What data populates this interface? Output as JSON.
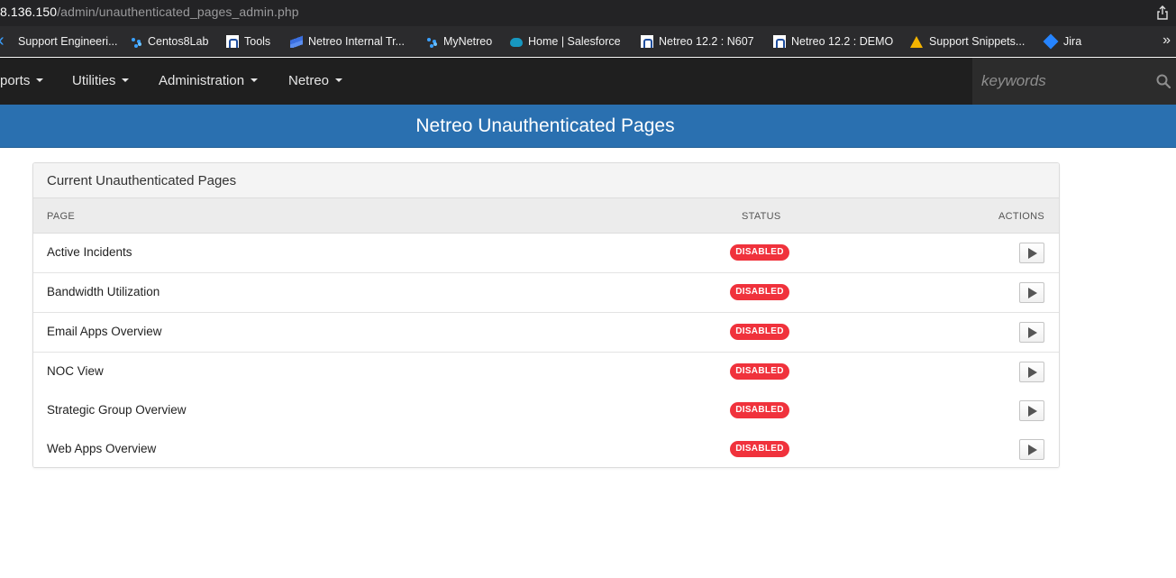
{
  "browser": {
    "url_host": "8.136.150",
    "url_path": "/admin/unauthenticated_pages_admin.php",
    "bookmarks": [
      {
        "label": "Support Engineeri...",
        "icon": "chevron-icon"
      },
      {
        "label": "Centos8Lab",
        "icon": "dots-icon"
      },
      {
        "label": "Tools",
        "icon": "netreo-icon"
      },
      {
        "label": "Netreo Internal Tr...",
        "icon": "wave-icon"
      },
      {
        "label": "MyNetreo",
        "icon": "dots-icon"
      },
      {
        "label": "Home | Salesforce",
        "icon": "salesforce-cloud-icon"
      },
      {
        "label": "Netreo 12.2 : N607",
        "icon": "netreo-icon"
      },
      {
        "label": "Netreo 12.2 : DEMO",
        "icon": "netreo-icon"
      },
      {
        "label": "Support Snippets...",
        "icon": "google-drive-icon"
      },
      {
        "label": "Jira",
        "icon": "jira-icon"
      }
    ],
    "more_label": "»"
  },
  "nav": {
    "items": [
      {
        "label": "ports"
      },
      {
        "label": "Utilities"
      },
      {
        "label": "Administration"
      },
      {
        "label": "Netreo"
      }
    ],
    "search_placeholder": "keywords"
  },
  "page": {
    "title": "Netreo Unauthenticated Pages"
  },
  "panel": {
    "heading": "Current Unauthenticated Pages",
    "columns": {
      "page": "PAGE",
      "status": "STATUS",
      "actions": "ACTIONS"
    },
    "rows": [
      {
        "page": "Active Incidents",
        "status": "DISABLED"
      },
      {
        "page": "Bandwidth Utilization",
        "status": "DISABLED"
      },
      {
        "page": "Email Apps Overview",
        "status": "DISABLED"
      },
      {
        "page": "NOC View",
        "status": "DISABLED"
      },
      {
        "page": "Strategic Group Overview",
        "status": "DISABLED"
      },
      {
        "page": "Web Apps Overview",
        "status": "DISABLED"
      }
    ]
  },
  "colors": {
    "title_band": "#2a70b0",
    "badge_disabled": "#f0323c",
    "navbar": "#1f1f1f"
  }
}
